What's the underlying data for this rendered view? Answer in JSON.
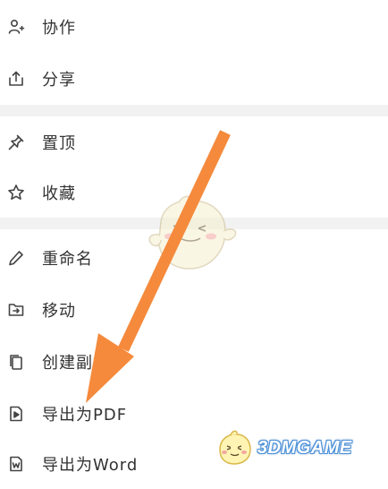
{
  "menu": {
    "items": [
      {
        "label": "协作",
        "icon": "add-user-icon"
      },
      {
        "label": "分享",
        "icon": "share-icon"
      },
      {
        "label": "置顶",
        "icon": "pin-icon"
      },
      {
        "label": "收藏",
        "icon": "star-icon"
      },
      {
        "label": "重命名",
        "icon": "pencil-icon"
      },
      {
        "label": "移动",
        "icon": "folder-move-icon"
      },
      {
        "label": "创建副",
        "icon": "copy-icon"
      },
      {
        "label": "导出为PDF",
        "icon": "pdf-file-icon"
      },
      {
        "label": "导出为Word",
        "icon": "word-file-icon"
      }
    ]
  },
  "overlay": {
    "arrow_color": "#f58a3c"
  },
  "watermark": {
    "text": "3DMGAME"
  }
}
